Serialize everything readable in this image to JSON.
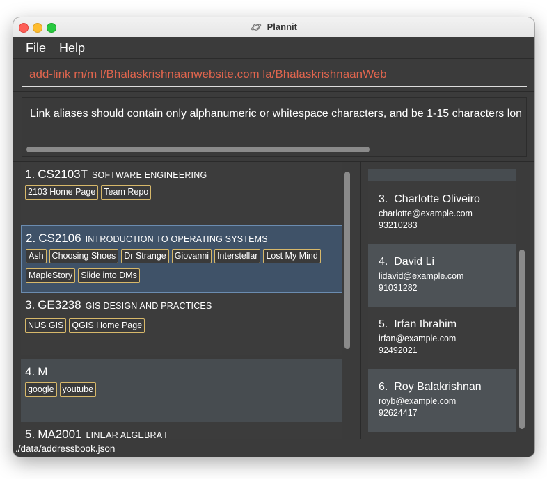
{
  "window": {
    "title": "Plannit"
  },
  "menu": {
    "file": "File",
    "help": "Help"
  },
  "command": {
    "value": "add-link m/m l/Bhalaskrishnaanwebsite.com la/BhalaskrishnaanWeb"
  },
  "result": {
    "text": "Link aliases should contain only alphanumeric or whitespace characters, and be 1-15 characters lon"
  },
  "modules": [
    {
      "index": "1.",
      "code": "CS2103T",
      "name": "SOFTWARE ENGINEERING",
      "tags": [
        "2103 Home Page",
        "Team Repo"
      ]
    },
    {
      "index": "2.",
      "code": "CS2106",
      "name": "INTRODUCTION TO OPERATING SYSTEMS",
      "tags": [
        "Ash",
        "Choosing Shoes",
        "Dr Strange",
        "Giovanni",
        "Interstellar",
        "Lost My Mind",
        "MapleStory",
        "Slide into DMs"
      ]
    },
    {
      "index": "3.",
      "code": "GE3238",
      "name": "GIS DESIGN AND PRACTICES",
      "tags": [
        "NUS GIS",
        "QGIS Home Page"
      ]
    },
    {
      "index": "4.",
      "code": "M",
      "name": "",
      "tags": [
        "google",
        "youtube"
      ]
    },
    {
      "index": "5.",
      "code": "MA2001",
      "name": "LINEAR ALGEBRA I",
      "tags": []
    }
  ],
  "persons": [
    {
      "index": "3.",
      "name": "Charlotte Oliveiro",
      "email": "charlotte@example.com",
      "phone": "93210283"
    },
    {
      "index": "4.",
      "name": "David Li",
      "email": "lidavid@example.com",
      "phone": "91031282"
    },
    {
      "index": "5.",
      "name": "Irfan Ibrahim",
      "email": "irfan@example.com",
      "phone": "92492021"
    },
    {
      "index": "6.",
      "name": "Roy Balakrishnan",
      "email": "royb@example.com",
      "phone": "92624417"
    }
  ],
  "status": {
    "path": "./data/addressbook.json"
  },
  "icons": {
    "app": "planet-icon"
  },
  "colors": {
    "command_text": "#e0654e",
    "tag_border": "#d7b86a",
    "selected_card": "#3f5268"
  }
}
